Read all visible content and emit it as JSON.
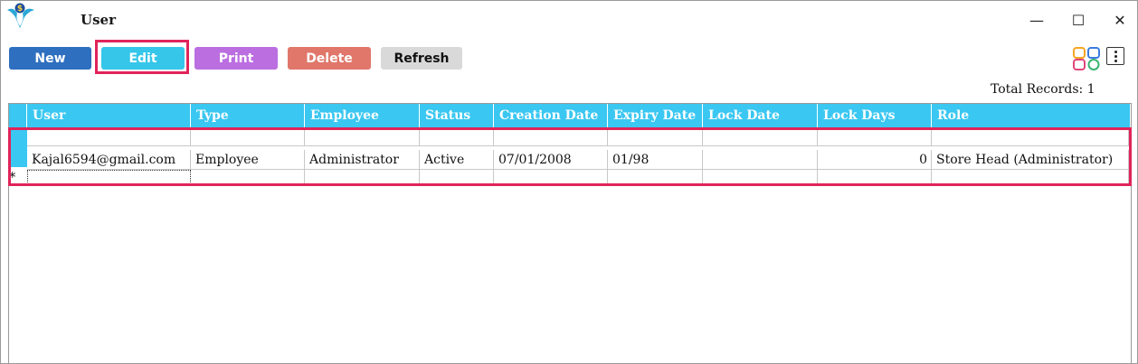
{
  "window": {
    "title": "User",
    "controls": {
      "minimize": "—",
      "maximize": "☐",
      "close": "✕"
    }
  },
  "toolbar": {
    "new_label": "New",
    "edit_label": "Edit",
    "print_label": "Print",
    "delete_label": "Delete",
    "refresh_label": "Refresh",
    "icons": [
      "layout-grid-icon",
      "more-vertical-icon"
    ]
  },
  "summary": {
    "total_records": "Total Records: 1"
  },
  "grid": {
    "columns": [
      "User",
      "Type",
      "Employee",
      "Status",
      "Creation Date",
      "Expiry Date",
      "Lock Date",
      "Lock Days",
      "Role"
    ],
    "filter_row": [
      "",
      "",
      "",
      "",
      "",
      "",
      "",
      "",
      ""
    ],
    "rows": [
      [
        "Kajal6594@gmail.com",
        "Employee",
        "Administrator",
        "Active",
        "07/01/2008",
        "01/98",
        "",
        "0",
        "Store Head (Administrator)"
      ]
    ],
    "new_row_marker": "*"
  },
  "colors": {
    "header": "#3ac7f1",
    "new": "#2e6fbf",
    "edit": "#35c6ea",
    "print": "#bb6ee0",
    "delete": "#e0776a",
    "refresh": "#d9d9d9",
    "highlight": "#e0245a"
  }
}
